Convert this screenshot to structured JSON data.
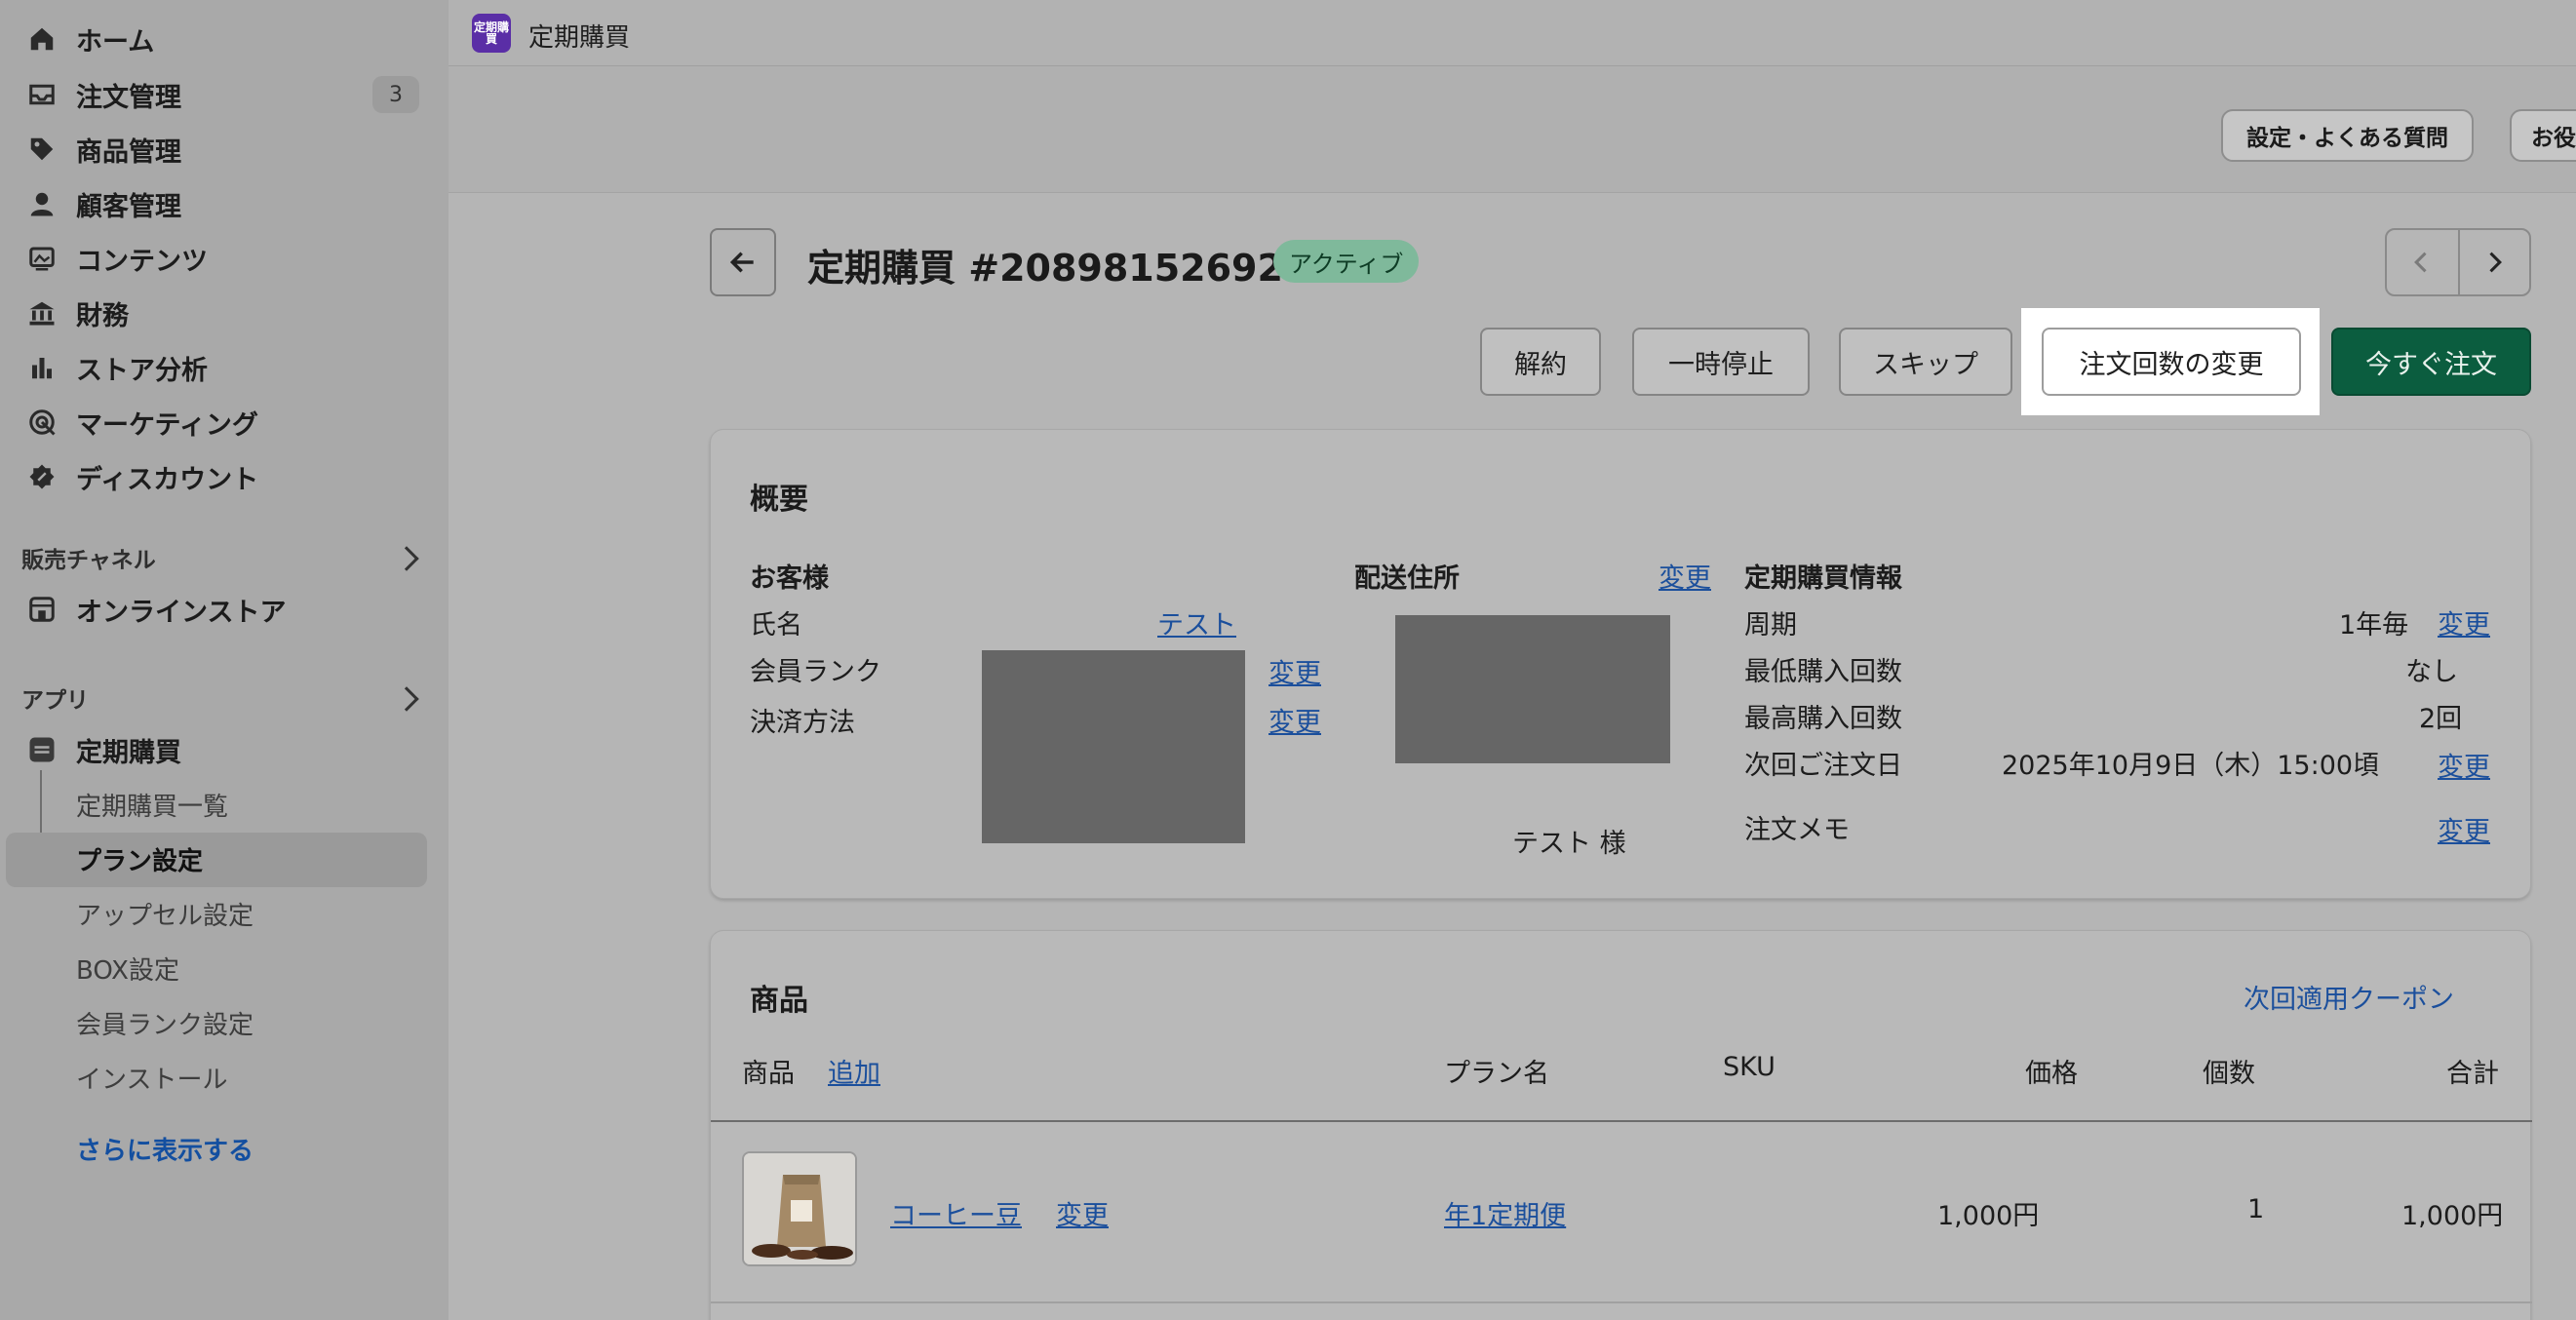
{
  "sidebar": {
    "items": [
      {
        "label": "ホーム",
        "icon": "home-icon"
      },
      {
        "label": "注文管理",
        "icon": "inbox-icon",
        "badge": "3"
      },
      {
        "label": "商品管理",
        "icon": "tag-icon"
      },
      {
        "label": "顧客管理",
        "icon": "person-icon"
      },
      {
        "label": "コンテンツ",
        "icon": "image-icon"
      },
      {
        "label": "財務",
        "icon": "bank-icon"
      },
      {
        "label": "ストア分析",
        "icon": "chart-bar-icon"
      },
      {
        "label": "マーケティング",
        "icon": "target-icon"
      },
      {
        "label": "ディスカウント",
        "icon": "discount-icon"
      }
    ],
    "sales_channels_label": "販売チャネル",
    "online_store_label": "オンラインストア",
    "apps_label": "アプリ",
    "app_name": "定期購買",
    "sub_items": [
      "定期購買一覧",
      "プラン設定",
      "アップセル設定",
      "BOX設定",
      "会員ランク設定",
      "インストール"
    ],
    "active_sub_item": "プラン設定",
    "show_more_label": "さらに表示する"
  },
  "topbar": {
    "app_logo_text": "定期購買",
    "app_name": "定期購買"
  },
  "header": {
    "settings_faq_label": "設定・よくある質問",
    "helpful_label": "お役"
  },
  "page": {
    "title": "定期購買 #20898152692",
    "status": "アクティブ",
    "status_color": "#7fb99b"
  },
  "actions": {
    "cancel": "解約",
    "pause": "一時停止",
    "skip": "スキップ",
    "change_count": "注文回数の変更",
    "order_now": "今すぐ注文",
    "primary_color": "#0b5d3f"
  },
  "overview": {
    "title": "概要",
    "customer_heading": "お客様",
    "name_label": "氏名",
    "name_value": "テスト",
    "member_rank_label": "会員ランク",
    "payment_label": "決済方法",
    "change": "変更",
    "shipping_heading": "配送住所",
    "shipping_name": "テスト 様",
    "sub_info_heading": "定期購買情報",
    "cycle_label": "周期",
    "cycle_value": "1年毎",
    "min_label": "最低購入回数",
    "min_value": "なし",
    "max_label": "最高購入回数",
    "max_value": "2回",
    "next_label": "次回ご注文日",
    "next_value": "2025年10月9日（木）15:00頃",
    "memo_label": "注文メモ"
  },
  "products": {
    "title": "商品",
    "coupon_link": "次回適用クーポン",
    "columns": {
      "product": "商品",
      "add": "追加",
      "plan": "プラン名",
      "sku": "SKU",
      "price": "価格",
      "qty": "個数",
      "total": "合計"
    },
    "rows": [
      {
        "name": "コーヒー豆",
        "change": "変更",
        "plan": "年1定期便",
        "sku": "",
        "price": "1,000円",
        "qty": "1",
        "total": "1,000円"
      }
    ]
  }
}
